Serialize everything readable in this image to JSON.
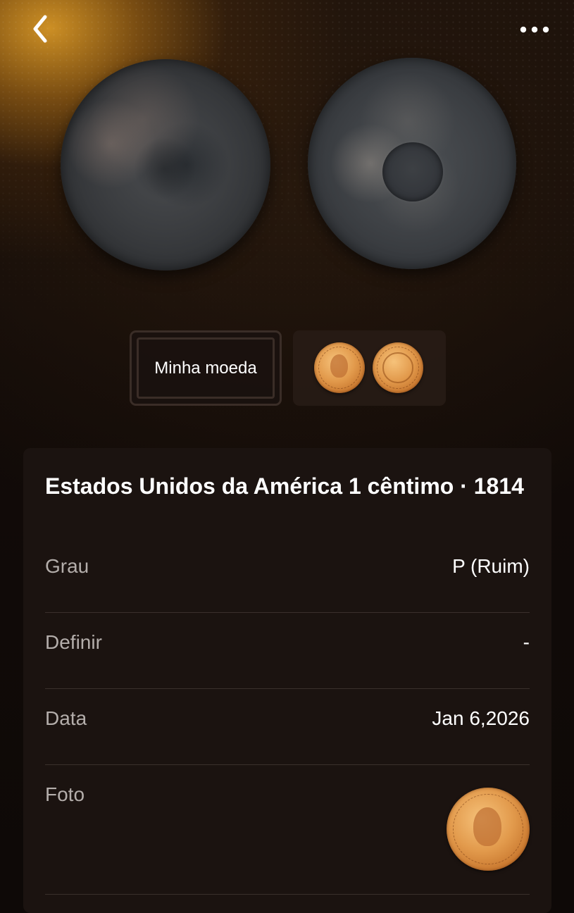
{
  "header": {
    "back_icon": "chevron-left-icon",
    "more_icon": "more-horizontal-icon"
  },
  "tabs": {
    "my_coin_label": "Minha moeda"
  },
  "coin": {
    "title": "Estados Unidos da América 1 cêntimo · 1814"
  },
  "details": [
    {
      "label": "Grau",
      "value": "P (Ruim)"
    },
    {
      "label": "Definir",
      "value": "-"
    },
    {
      "label": "Data",
      "value": "Jan 6,2026"
    },
    {
      "label": "Foto"
    }
  ],
  "colors": {
    "background": "#0e0907",
    "card": "#1b1310",
    "accent_glow": "#d69626",
    "label_gray": "#b4aeab",
    "divider": "#3a302c"
  }
}
